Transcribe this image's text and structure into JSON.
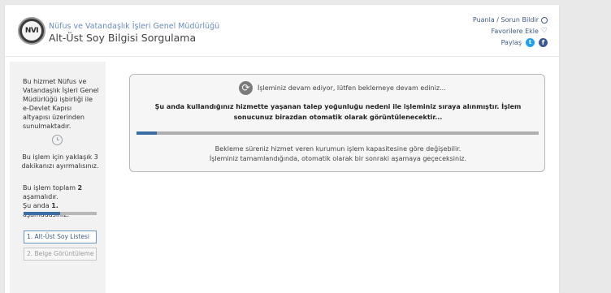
{
  "header": {
    "logo_text": "NVI",
    "org_name": "Nüfus ve Vatandaşlık İşleri Genel Müdürlüğü",
    "page_title": "Alt-Üst Soy Bilgisi Sorgulama",
    "links": {
      "rate": "Puanla / Sorun Bildir",
      "favorites": "Favorilere Ekle",
      "share": "Paylaş"
    }
  },
  "sidebar": {
    "description": "Bu hizmet Nüfus ve Vatandaşlık İşleri Genel Müdürlüğü işbirliği ile e-Devlet Kapısı altyapısı üzerinden sunulmaktadır.",
    "time_estimate": "Bu işlem için yaklaşık 3 dakikanızı ayırmalısınız.",
    "steps_text_1": "Bu işlem toplam ",
    "steps_total": "2",
    "steps_text_2": " aşamalıdır.",
    "steps_text_3": "Şu anda ",
    "steps_current": "1.",
    "steps_text_4": " aşamadasınız.",
    "progress_fraction": 0.5,
    "steps": [
      {
        "label": "1. Alt-Üst Soy Listesi"
      },
      {
        "label": "2. Belge Görüntüleme"
      }
    ]
  },
  "main": {
    "status": "İşleminiz devam ediyor, lütfen beklemeye devam ediniz...",
    "bold_message": "Şu anda kullandığınız hizmette yaşanan talep yoğunluğu nedeni ile işleminiz sıraya alınmıştır. İşlem sonucunuz birazdan otomatik olarak görüntülenecektir...",
    "progress_fraction": 0.05,
    "info_line_1": "Bekleme süreniz hizmet veren kurumun işlem kapasitesine göre değişebilir.",
    "info_line_2": "İşleminiz tamamlandığında, otomatik olarak bir sonraki aşamaya geçeceksiniz."
  },
  "colors": {
    "accent": "#3a6ea5",
    "link": "#3d5a80",
    "org_name": "#6a8bbd"
  }
}
